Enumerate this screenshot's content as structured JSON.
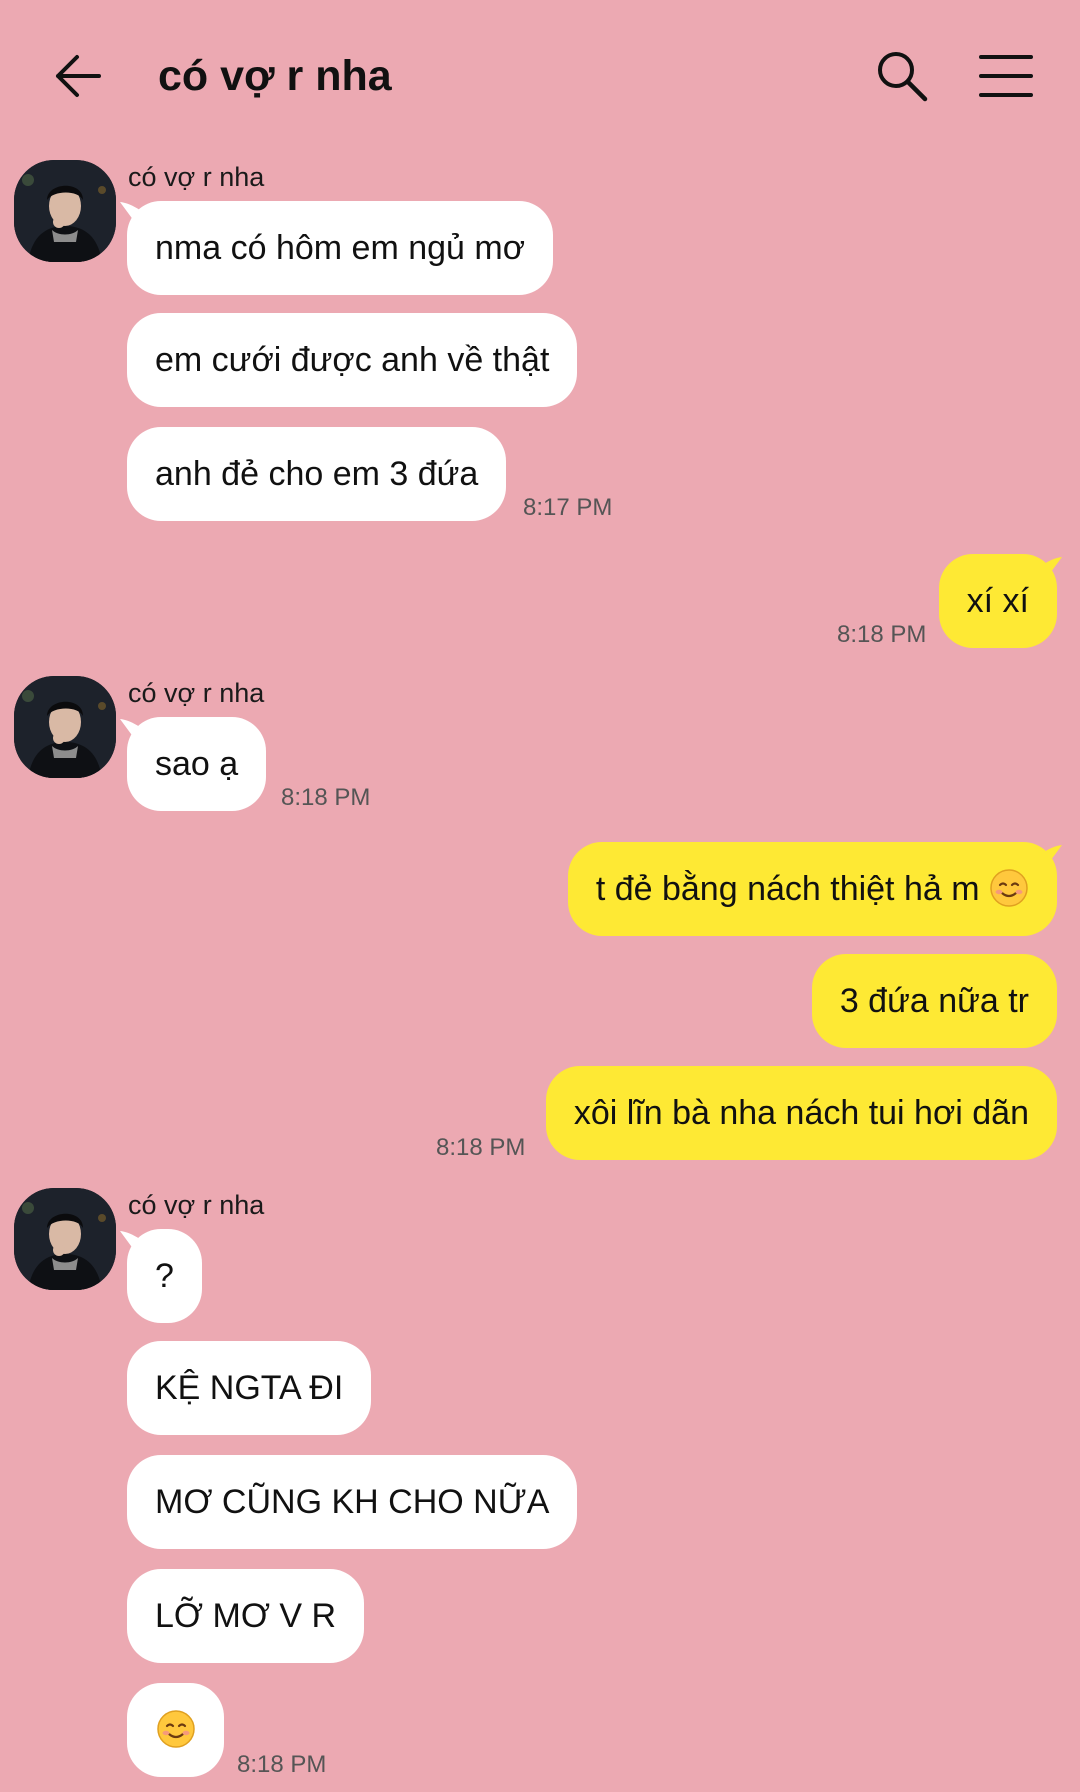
{
  "header": {
    "title": "có vợ r nha"
  },
  "contact": {
    "name": "có vợ r nha"
  },
  "groups": [
    {
      "messages": [
        "nma có hôm em ngủ mơ",
        "em cưới được anh về thật",
        "anh đẻ cho em 3 đứa"
      ],
      "time": "8:17 PM"
    },
    {
      "messages": [
        "xí xí"
      ],
      "time": "8:18 PM"
    },
    {
      "messages": [
        "sao ạ"
      ],
      "time": "8:18 PM"
    },
    {
      "messages": [
        "t đẻ bằng nách thiệt hả m",
        "3 đứa nữa tr",
        "xôi lĩn bà nha nách tui hơi dãn"
      ],
      "time": "8:18 PM"
    },
    {
      "messages": [
        "?",
        "KỆ NGTA ĐI",
        "MƠ CŨNG KH CHO NỮA",
        "LỠ MƠ V R",
        ""
      ],
      "time": "8:18 PM"
    }
  ],
  "colors": {
    "background": "#ECA9B2",
    "incoming_bubble": "#FFFFFF",
    "outgoing_bubble": "#FEE934",
    "timestamp": "#555555"
  },
  "icons": {
    "back": "arrow-left-icon",
    "search": "search-icon",
    "menu": "hamburger-menu-icon",
    "emoji": "smiling-face-emoji-icon"
  }
}
